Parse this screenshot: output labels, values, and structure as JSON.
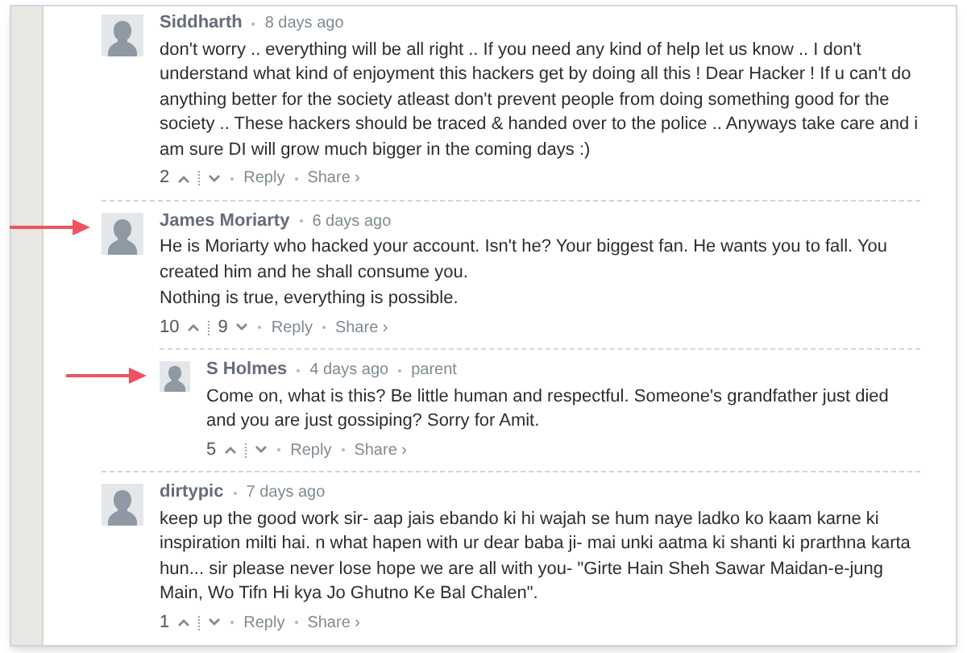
{
  "comments": [
    {
      "author": "Siddharth",
      "time": "8 days ago",
      "paragraphs": [
        "don't worry .. everything will be all right .. If you need any kind of help let us know .. I don't understand what kind of enjoyment this hackers get by doing all this ! Dear Hacker ! If u can't do anything better for the society atleast don't prevent people from doing something good for the society .. These hackers should be traced & handed over to the police .. Anyways take care and i am sure DI will grow much bigger in the coming days :)"
      ],
      "upvotes": "2",
      "reply": "Reply",
      "share": "Share ›",
      "highlighted": false
    },
    {
      "author": "James Moriarty",
      "time": "6 days ago",
      "paragraphs": [
        "He is Moriarty who hacked your account. Isn't he? Your biggest fan. He wants you to fall. You created him and he shall consume you.",
        "Nothing is true, everything is possible."
      ],
      "upvotes": "10",
      "downvotes": "9",
      "reply": "Reply",
      "share": "Share ›",
      "highlighted": true,
      "children": [
        {
          "author": "S Holmes",
          "time": "4 days ago",
          "tag": "parent",
          "paragraphs": [
            "Come on, what is this? Be little human and respectful. Someone's grandfather just died and you are just gossiping? Sorry for Amit."
          ],
          "upvotes": "5",
          "reply": "Reply",
          "share": "Share ›",
          "highlighted": true
        }
      ]
    },
    {
      "author": "dirtypic",
      "time": "7 days ago",
      "paragraphs": [
        "keep up the good work sir- aap jais ebando ki hi wajah se hum naye ladko ko kaam karne ki inspiration milti hai. n what hapen with ur dear baba ji- mai unki aatma ki shanti ki prarthna karta hun... sir please never lose hope we are all with you- \"Girte Hain Sheh Sawar Maidan-e-jung Main, Wo Tifn Hi kya Jo Ghutno Ke Bal Chalen\"."
      ],
      "upvotes": "1",
      "reply": "Reply",
      "share": "Share ›",
      "highlighted": false
    }
  ]
}
